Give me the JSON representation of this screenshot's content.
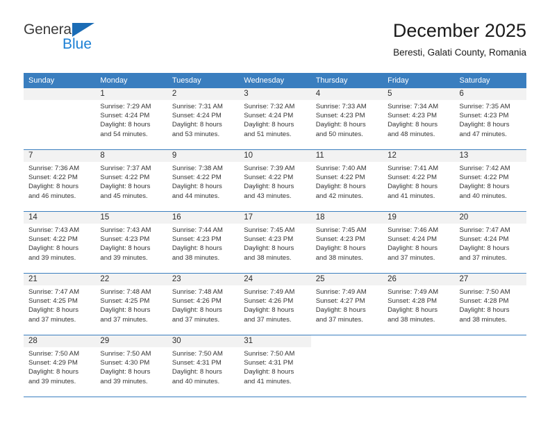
{
  "brand": {
    "name_part1": "General",
    "name_part2": "Blue",
    "accent_color": "#1b7fd4",
    "triangle_color": "#1b6cb5"
  },
  "header": {
    "title": "December 2025",
    "subtitle": "Beresti, Galati County, Romania"
  },
  "calendar": {
    "header_bg": "#3a7ebf",
    "daynum_bg": "#f2f2f2",
    "weekdays": [
      "Sunday",
      "Monday",
      "Tuesday",
      "Wednesday",
      "Thursday",
      "Friday",
      "Saturday"
    ],
    "weeks": [
      [
        {
          "day": "",
          "lines": []
        },
        {
          "day": "1",
          "lines": [
            "Sunrise: 7:29 AM",
            "Sunset: 4:24 PM",
            "Daylight: 8 hours",
            "and 54 minutes."
          ]
        },
        {
          "day": "2",
          "lines": [
            "Sunrise: 7:31 AM",
            "Sunset: 4:24 PM",
            "Daylight: 8 hours",
            "and 53 minutes."
          ]
        },
        {
          "day": "3",
          "lines": [
            "Sunrise: 7:32 AM",
            "Sunset: 4:24 PM",
            "Daylight: 8 hours",
            "and 51 minutes."
          ]
        },
        {
          "day": "4",
          "lines": [
            "Sunrise: 7:33 AM",
            "Sunset: 4:23 PM",
            "Daylight: 8 hours",
            "and 50 minutes."
          ]
        },
        {
          "day": "5",
          "lines": [
            "Sunrise: 7:34 AM",
            "Sunset: 4:23 PM",
            "Daylight: 8 hours",
            "and 48 minutes."
          ]
        },
        {
          "day": "6",
          "lines": [
            "Sunrise: 7:35 AM",
            "Sunset: 4:23 PM",
            "Daylight: 8 hours",
            "and 47 minutes."
          ]
        }
      ],
      [
        {
          "day": "7",
          "lines": [
            "Sunrise: 7:36 AM",
            "Sunset: 4:22 PM",
            "Daylight: 8 hours",
            "and 46 minutes."
          ]
        },
        {
          "day": "8",
          "lines": [
            "Sunrise: 7:37 AM",
            "Sunset: 4:22 PM",
            "Daylight: 8 hours",
            "and 45 minutes."
          ]
        },
        {
          "day": "9",
          "lines": [
            "Sunrise: 7:38 AM",
            "Sunset: 4:22 PM",
            "Daylight: 8 hours",
            "and 44 minutes."
          ]
        },
        {
          "day": "10",
          "lines": [
            "Sunrise: 7:39 AM",
            "Sunset: 4:22 PM",
            "Daylight: 8 hours",
            "and 43 minutes."
          ]
        },
        {
          "day": "11",
          "lines": [
            "Sunrise: 7:40 AM",
            "Sunset: 4:22 PM",
            "Daylight: 8 hours",
            "and 42 minutes."
          ]
        },
        {
          "day": "12",
          "lines": [
            "Sunrise: 7:41 AM",
            "Sunset: 4:22 PM",
            "Daylight: 8 hours",
            "and 41 minutes."
          ]
        },
        {
          "day": "13",
          "lines": [
            "Sunrise: 7:42 AM",
            "Sunset: 4:22 PM",
            "Daylight: 8 hours",
            "and 40 minutes."
          ]
        }
      ],
      [
        {
          "day": "14",
          "lines": [
            "Sunrise: 7:43 AM",
            "Sunset: 4:22 PM",
            "Daylight: 8 hours",
            "and 39 minutes."
          ]
        },
        {
          "day": "15",
          "lines": [
            "Sunrise: 7:43 AM",
            "Sunset: 4:23 PM",
            "Daylight: 8 hours",
            "and 39 minutes."
          ]
        },
        {
          "day": "16",
          "lines": [
            "Sunrise: 7:44 AM",
            "Sunset: 4:23 PM",
            "Daylight: 8 hours",
            "and 38 minutes."
          ]
        },
        {
          "day": "17",
          "lines": [
            "Sunrise: 7:45 AM",
            "Sunset: 4:23 PM",
            "Daylight: 8 hours",
            "and 38 minutes."
          ]
        },
        {
          "day": "18",
          "lines": [
            "Sunrise: 7:45 AM",
            "Sunset: 4:23 PM",
            "Daylight: 8 hours",
            "and 38 minutes."
          ]
        },
        {
          "day": "19",
          "lines": [
            "Sunrise: 7:46 AM",
            "Sunset: 4:24 PM",
            "Daylight: 8 hours",
            "and 37 minutes."
          ]
        },
        {
          "day": "20",
          "lines": [
            "Sunrise: 7:47 AM",
            "Sunset: 4:24 PM",
            "Daylight: 8 hours",
            "and 37 minutes."
          ]
        }
      ],
      [
        {
          "day": "21",
          "lines": [
            "Sunrise: 7:47 AM",
            "Sunset: 4:25 PM",
            "Daylight: 8 hours",
            "and 37 minutes."
          ]
        },
        {
          "day": "22",
          "lines": [
            "Sunrise: 7:48 AM",
            "Sunset: 4:25 PM",
            "Daylight: 8 hours",
            "and 37 minutes."
          ]
        },
        {
          "day": "23",
          "lines": [
            "Sunrise: 7:48 AM",
            "Sunset: 4:26 PM",
            "Daylight: 8 hours",
            "and 37 minutes."
          ]
        },
        {
          "day": "24",
          "lines": [
            "Sunrise: 7:49 AM",
            "Sunset: 4:26 PM",
            "Daylight: 8 hours",
            "and 37 minutes."
          ]
        },
        {
          "day": "25",
          "lines": [
            "Sunrise: 7:49 AM",
            "Sunset: 4:27 PM",
            "Daylight: 8 hours",
            "and 37 minutes."
          ]
        },
        {
          "day": "26",
          "lines": [
            "Sunrise: 7:49 AM",
            "Sunset: 4:28 PM",
            "Daylight: 8 hours",
            "and 38 minutes."
          ]
        },
        {
          "day": "27",
          "lines": [
            "Sunrise: 7:50 AM",
            "Sunset: 4:28 PM",
            "Daylight: 8 hours",
            "and 38 minutes."
          ]
        }
      ],
      [
        {
          "day": "28",
          "lines": [
            "Sunrise: 7:50 AM",
            "Sunset: 4:29 PM",
            "Daylight: 8 hours",
            "and 39 minutes."
          ]
        },
        {
          "day": "29",
          "lines": [
            "Sunrise: 7:50 AM",
            "Sunset: 4:30 PM",
            "Daylight: 8 hours",
            "and 39 minutes."
          ]
        },
        {
          "day": "30",
          "lines": [
            "Sunrise: 7:50 AM",
            "Sunset: 4:31 PM",
            "Daylight: 8 hours",
            "and 40 minutes."
          ]
        },
        {
          "day": "31",
          "lines": [
            "Sunrise: 7:50 AM",
            "Sunset: 4:31 PM",
            "Daylight: 8 hours",
            "and 41 minutes."
          ]
        },
        {
          "day": "",
          "lines": []
        },
        {
          "day": "",
          "lines": []
        },
        {
          "day": "",
          "lines": []
        }
      ]
    ]
  }
}
